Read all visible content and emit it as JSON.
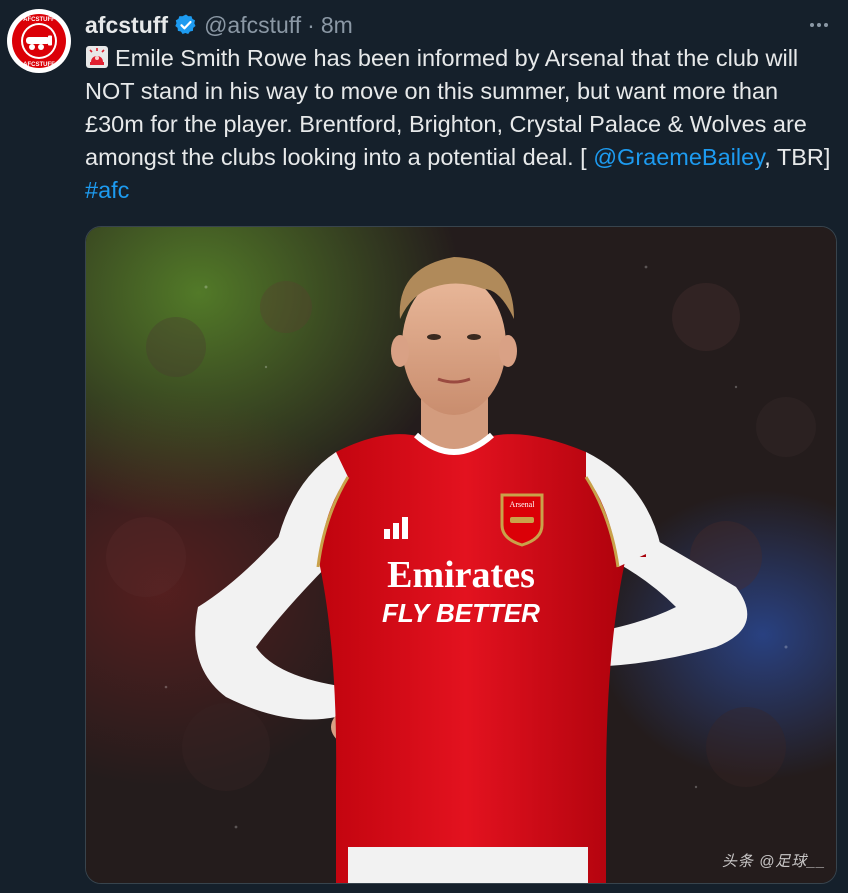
{
  "author": {
    "display_name": "afcstuff",
    "handle": "@afcstuff",
    "separator": "·",
    "time": "8m",
    "avatar_text_top": "AFCSTUFF",
    "avatar_text_bottom": "AFCSTUFF"
  },
  "tweet": {
    "text_main": "Emile Smith Rowe has been informed by Arsenal that the club will NOT stand in his way to move on this summer, but want more than £30m for the player. Brentford, Brighton, Crystal Palace & Wolves are amongst the clubs looking into a potential deal. [ ",
    "mention": "@GraemeBailey",
    "text_after_mention": ", TBR] ",
    "hashtag": "#afc"
  },
  "media": {
    "jersey_sponsor_line1": "Emirates",
    "jersey_sponsor_line2": "FLY BETTER",
    "crest_text": "Arsenal",
    "watermark": "头条 @足球__"
  },
  "icons": {
    "verified": "verified-badge-icon",
    "more": "more-options-icon",
    "siren": "police-light-emoji-icon"
  },
  "colors": {
    "background": "#15202b",
    "link": "#1d9bf0",
    "secondary_text": "#8b98a5",
    "verified": "#1d9bf0",
    "arsenal_red": "#db0007"
  }
}
